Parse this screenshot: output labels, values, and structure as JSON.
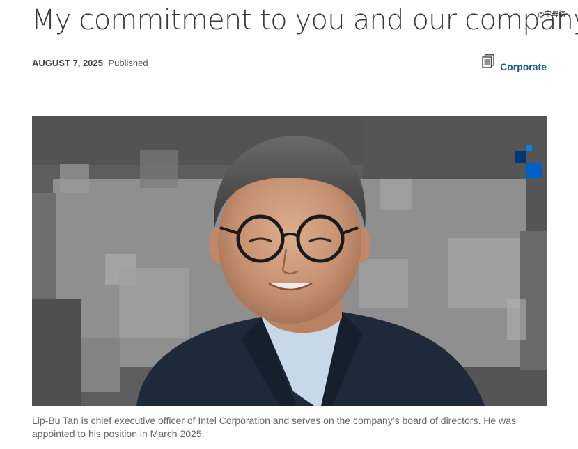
{
  "article": {
    "title": "My commitment to you and our company",
    "date": "AUGUST 7, 2025",
    "status": "Published",
    "category": {
      "label": "Corporate",
      "icon": "document-stack-icon"
    },
    "hero_image": {
      "description_icon": "portrait-photo"
    },
    "caption": "Lip-Bu Tan is chief executive officer of Intel Corporation and serves on the company’s board of directors. He was appointed to his position in March 2025."
  },
  "watermark": {
    "text": "@字母榜"
  },
  "colors": {
    "link": "#1c5d84",
    "title": "#3a3a3a",
    "accent_blue": "#0068b5"
  }
}
